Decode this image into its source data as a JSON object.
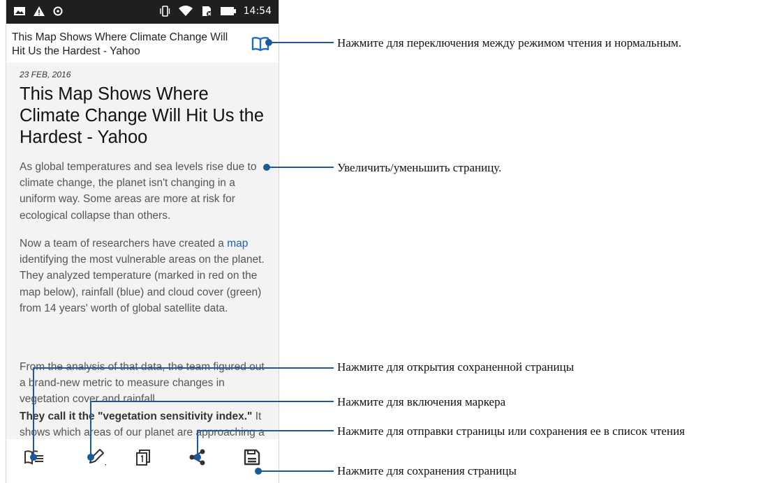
{
  "status_bar": {
    "time": "14:54",
    "left_icons": [
      "image-icon",
      "warning-icon",
      "sync-icon"
    ],
    "right_icons": [
      "vibrate-icon",
      "wifi-icon",
      "sim-icon",
      "battery-icon"
    ]
  },
  "title_bar": {
    "title": "This Map Shows Where Climate Change Will Hit Us the Hardest - Yahoo",
    "reader_icon": "book-open-icon"
  },
  "article": {
    "date": "23 FEB, 2016",
    "heading": "This Map Shows Where Climate Change Will Hit Us the Hardest - Yahoo",
    "p1": "As global temperatures and sea levels rise due to climate change, the planet isn't changing in a uniform way. Some areas are more at risk for ecological collapse than others.",
    "p2_before_link": "Now a team of researchers have created a ",
    "p2_link": "map",
    "p2_after_link": " identifying the most vulnerable areas on the planet. They analyzed temperature (marked in red on the map below), rainfall (blue) and cloud cover (green) from 14 years' worth of global satellite data.",
    "p3": "From the analysis of that data, the team figured out a brand-new metric to measure changes in vegetation cover and rainfall.",
    "p4_bold": "They call it the \"vegetation sensitivity index.\"",
    "p4_rest": " It shows which areas of our planet are approaching a dangerous tipping point."
  },
  "toolbar": {
    "buttons": [
      "reading-list-icon",
      "marker-pen-icon",
      "tabs-icon",
      "share-icon",
      "save-page-icon"
    ]
  },
  "callouts": {
    "reader_mode": "Нажмите для переключения между режимом чтения и нормальным.",
    "zoom": "Увеличить/уменьшить страницу.",
    "open_saved": "Нажмите для открытия сохраненной страницы",
    "marker": "Нажмите для включения маркера",
    "share": "Нажмите для отправки страницы или сохранения ее в список чтения",
    "save": "Нажмите для сохранения страницы"
  },
  "colors": {
    "accent": "#1a5a9a",
    "link": "#1e5bb8",
    "status_bar": "#1f1f1f",
    "content_bg": "#f3f3f3"
  }
}
